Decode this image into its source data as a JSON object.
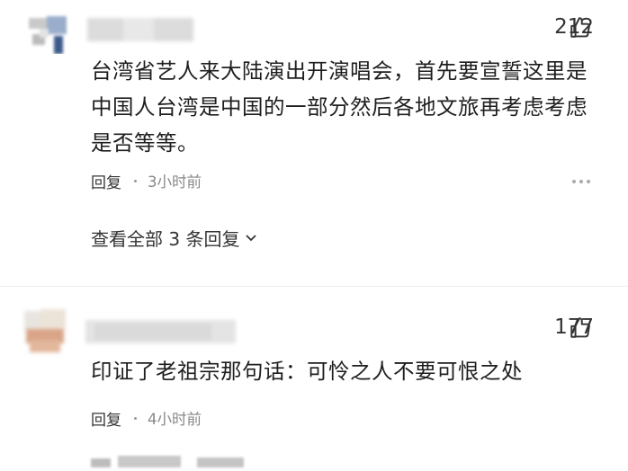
{
  "comments": [
    {
      "likes": "212",
      "text": "台湾省艺人来大陆演出开演唱会，首先要宣誓这里是中国人台湾是中国的一部分然后各地文旅再考虑考虑是否等等。",
      "reply_label": "回复",
      "time": "3小时前",
      "view_all": "查看全部 3 条回复"
    },
    {
      "likes": "177",
      "text": "印证了老祖宗那句话：可怜之人不要可恨之处",
      "reply_label": "回复",
      "time": "4小时前"
    }
  ],
  "icons": {
    "like": "thumbs-up-icon",
    "more": "more-dots-icon",
    "expand": "chevron-down-icon"
  }
}
